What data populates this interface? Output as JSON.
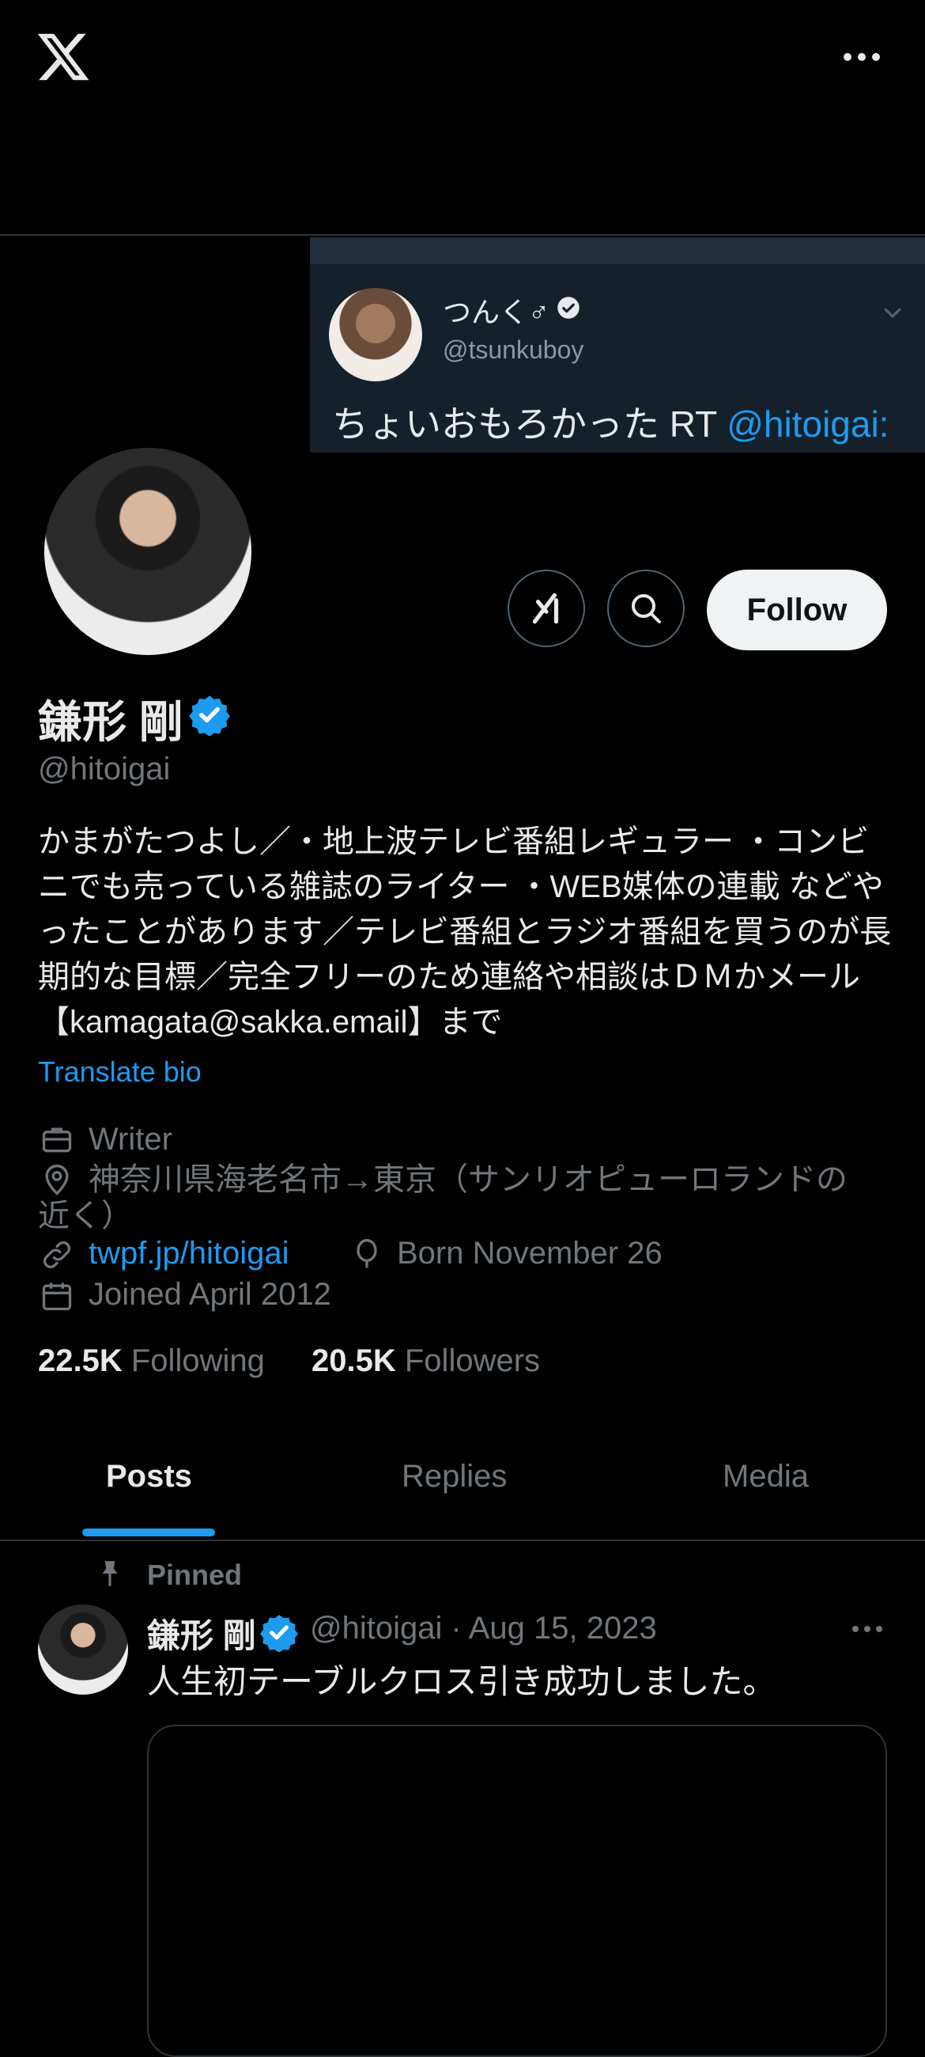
{
  "colors": {
    "background": "#000000",
    "accent": "#1d9bf0",
    "text": "#e7e9ea",
    "muted": "#71767b",
    "divider": "#2f3336"
  },
  "header": {
    "logo_icon": "x-logo-icon",
    "more_icon": "more-horizontal-icon"
  },
  "banner": {
    "name": "つんく♂",
    "handle": "@tsunkuboy",
    "text_prefix": "ちょいおもろかった RT ",
    "mention": "@hitoigai:"
  },
  "profile": {
    "name": "鎌形 剛",
    "handle": "@hitoigai",
    "bio": "かまがたつよし／・地上波テレビ番組レギュラー ・コンビニでも売っている雑誌のライター ・WEB媒体の連載 などやったことがあります／テレビ番組とラジオ番組を買うのが長期的な目標／完全フリーのため連絡や相談はＤＭかメール【kamagata@sakka.email】まで",
    "translate_label": "Translate bio",
    "profession": "Writer",
    "location": "神奈川県海老名市→東京（サンリオピューロランドの近く）",
    "website": "twpf.jp/hitoigai",
    "birthday": "Born November 26",
    "joined": "Joined April 2012",
    "following_count": "22.5K",
    "following_label": "Following",
    "followers_count": "20.5K",
    "followers_label": "Followers"
  },
  "actions": {
    "follow_label": "Follow"
  },
  "tabs": [
    {
      "label": "Posts",
      "active": true
    },
    {
      "label": "Replies",
      "active": false
    },
    {
      "label": "Media",
      "active": false
    }
  ],
  "pinned_post": {
    "pinned_label": "Pinned",
    "author_name": "鎌形 剛",
    "author_handle": "@hitoigai",
    "separator": "·",
    "date": "Aug 15, 2023",
    "text": "人生初テーブルクロス引き成功しました。"
  }
}
